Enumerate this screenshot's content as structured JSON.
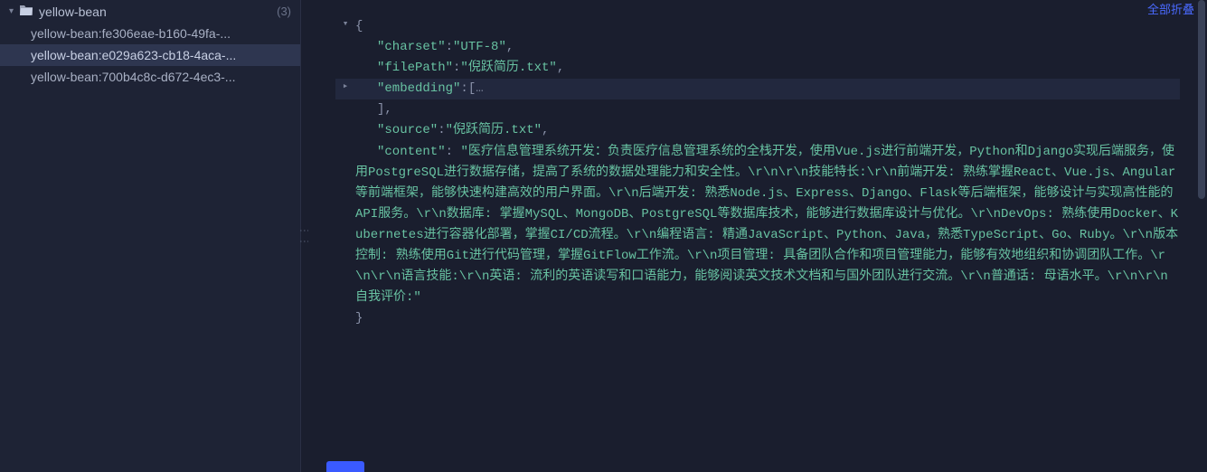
{
  "sidebar": {
    "root": {
      "name": "yellow-bean",
      "count": "(3)"
    },
    "items": [
      {
        "label": "yellow-bean:fe306eae-b160-49fa-..."
      },
      {
        "label": "yellow-bean:e029a623-cb18-4aca-..."
      },
      {
        "label": "yellow-bean:700b4c8c-d672-4ec3-..."
      }
    ],
    "selectedIndex": 1
  },
  "topRight": "全部折叠",
  "json": {
    "openBrace": "{",
    "closeBrace": "}",
    "closeArray": "],",
    "charset": {
      "key": "\"charset\"",
      "val": "\"UTF-8\""
    },
    "filePath": {
      "key": "\"filePath\"",
      "val": "\"倪跃简历.txt\""
    },
    "embedding": {
      "key": "\"embedding\"",
      "open": "[",
      "ellipsis": "…"
    },
    "source": {
      "key": "\"source\"",
      "val": "\"倪跃简历.txt\""
    },
    "content": {
      "key": "\"content\"",
      "val": "\"医疗信息管理系统开发：负责医疗信息管理系统的全栈开发，使用Vue.js进行前端开发，Python和Django实现后端服务，使用PostgreSQL进行数据存储，提高了系统的数据处理能力和安全性。\\r\\n\\r\\n技能特长:\\r\\n前端开发: 熟练掌握React、Vue.js、Angular等前端框架，能够快速构建高效的用户界面。\\r\\n后端开发: 熟悉Node.js、Express、Django、Flask等后端框架，能够设计与实现高性能的API服务。\\r\\n数据库: 掌握MySQL、MongoDB、PostgreSQL等数据库技术，能够进行数据库设计与优化。\\r\\nDevOps: 熟练使用Docker、Kubernetes进行容器化部署，掌握CI/CD流程。\\r\\n编程语言: 精通JavaScript、Python、Java，熟悉TypeScript、Go、Ruby。\\r\\n版本控制: 熟练使用Git进行代码管理，掌握GitFlow工作流。\\r\\n项目管理: 具备团队合作和项目管理能力，能够有效地组织和协调团队工作。\\r\\n\\r\\n语言技能:\\r\\n英语: 流利的英语读写和口语能力，能够阅读英文技术文档和与国外团队进行交流。\\r\\n普通话: 母语水平。\\r\\n\\r\\n自我评价:\""
    }
  }
}
